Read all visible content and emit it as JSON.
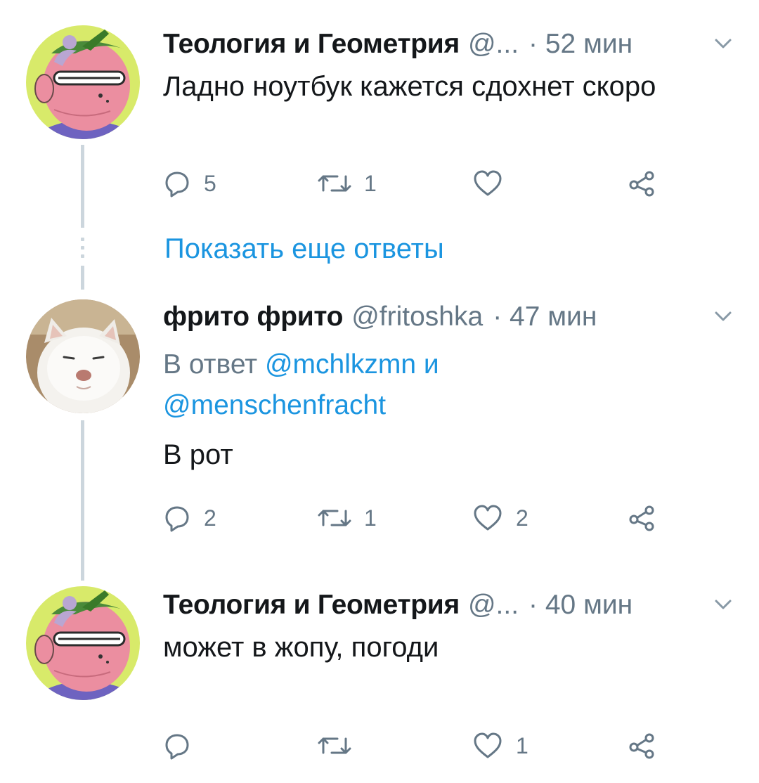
{
  "tweets": [
    {
      "name": "Теология и Геометрия",
      "handle": "@...",
      "time": "· 52 мин",
      "text": "Ладно ноутбук кажется сдохнет скоро",
      "counts": {
        "reply": "5",
        "retweet": "1",
        "like": ""
      }
    },
    {
      "name": "фрито фрито",
      "handle": "@fritoshka",
      "time": "· 47 мин",
      "reply_prefix": "В ответ",
      "reply_user1": "@mchlkzmn",
      "reply_and": "и",
      "reply_user2": "@menschenfracht",
      "text": "В рот",
      "counts": {
        "reply": "2",
        "retweet": "1",
        "like": "2"
      }
    },
    {
      "name": "Теология и Геометрия",
      "handle": "@...",
      "time": "· 40 мин",
      "text": "может в жопу, погоди",
      "counts": {
        "reply": "",
        "retweet": "",
        "like": "1"
      }
    }
  ],
  "show_more": "Показать еще ответы",
  "colors": {
    "link": "#1b95e0",
    "meta": "#657786",
    "line": "#ccd6dd"
  }
}
